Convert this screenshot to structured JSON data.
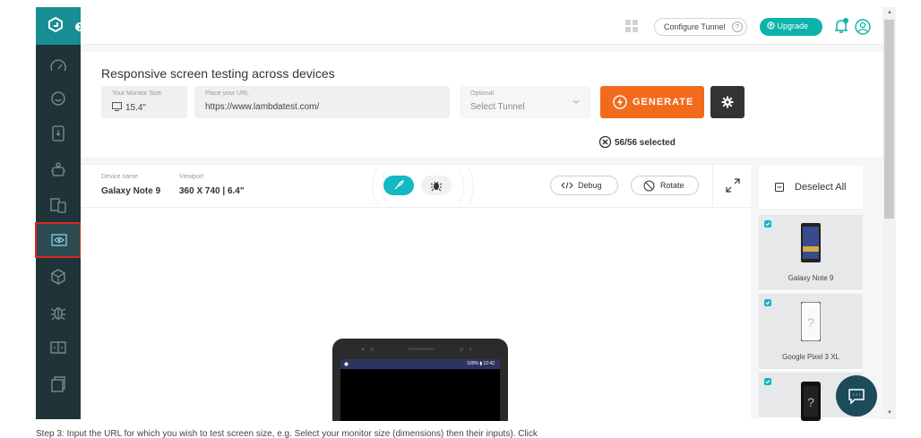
{
  "header": {
    "configure_tunnel": "Configure Tunnel",
    "help_mark": "?",
    "upgrade": "Upgrade"
  },
  "hero": {
    "title": "Responsive screen testing across devices",
    "monitor_label": "Your Monitor Size",
    "monitor_value": "15.4\"",
    "url_label": "Place your URL",
    "url_value": "https://www.lambdatest.com/",
    "tunnel_label": "Optional",
    "tunnel_value": "Select Tunnel",
    "generate": "GENERATE",
    "selected": "56/56 selected"
  },
  "viewer": {
    "device_name_label": "Device name",
    "device_name": "Galaxy Note 9",
    "viewport_label": "Viewport",
    "viewport": "360 X 740 | 6.4\"",
    "debug": "Debug",
    "rotate": "Rotate",
    "phone_status": "100% ▮ 12:42"
  },
  "device_list": {
    "deselect_all": "Deselect All",
    "devices": [
      {
        "name": "Galaxy Note 9",
        "checked": true
      },
      {
        "name": "Google Pixel 3 XL",
        "checked": true
      },
      {
        "name": "",
        "checked": true
      }
    ]
  },
  "sidebar": {
    "items": [
      "speedometer-icon",
      "smiley-icon",
      "mobile-icon",
      "robot-icon",
      "devices-icon",
      "eye-icon",
      "box-icon",
      "bug-icon",
      "compare-icon",
      "files-icon"
    ],
    "active_index": 5
  },
  "caption": "Step 3: Input the URL for which you wish to test screen size, e.g. Select your monitor size (dimensions) then their inputs). Click"
}
